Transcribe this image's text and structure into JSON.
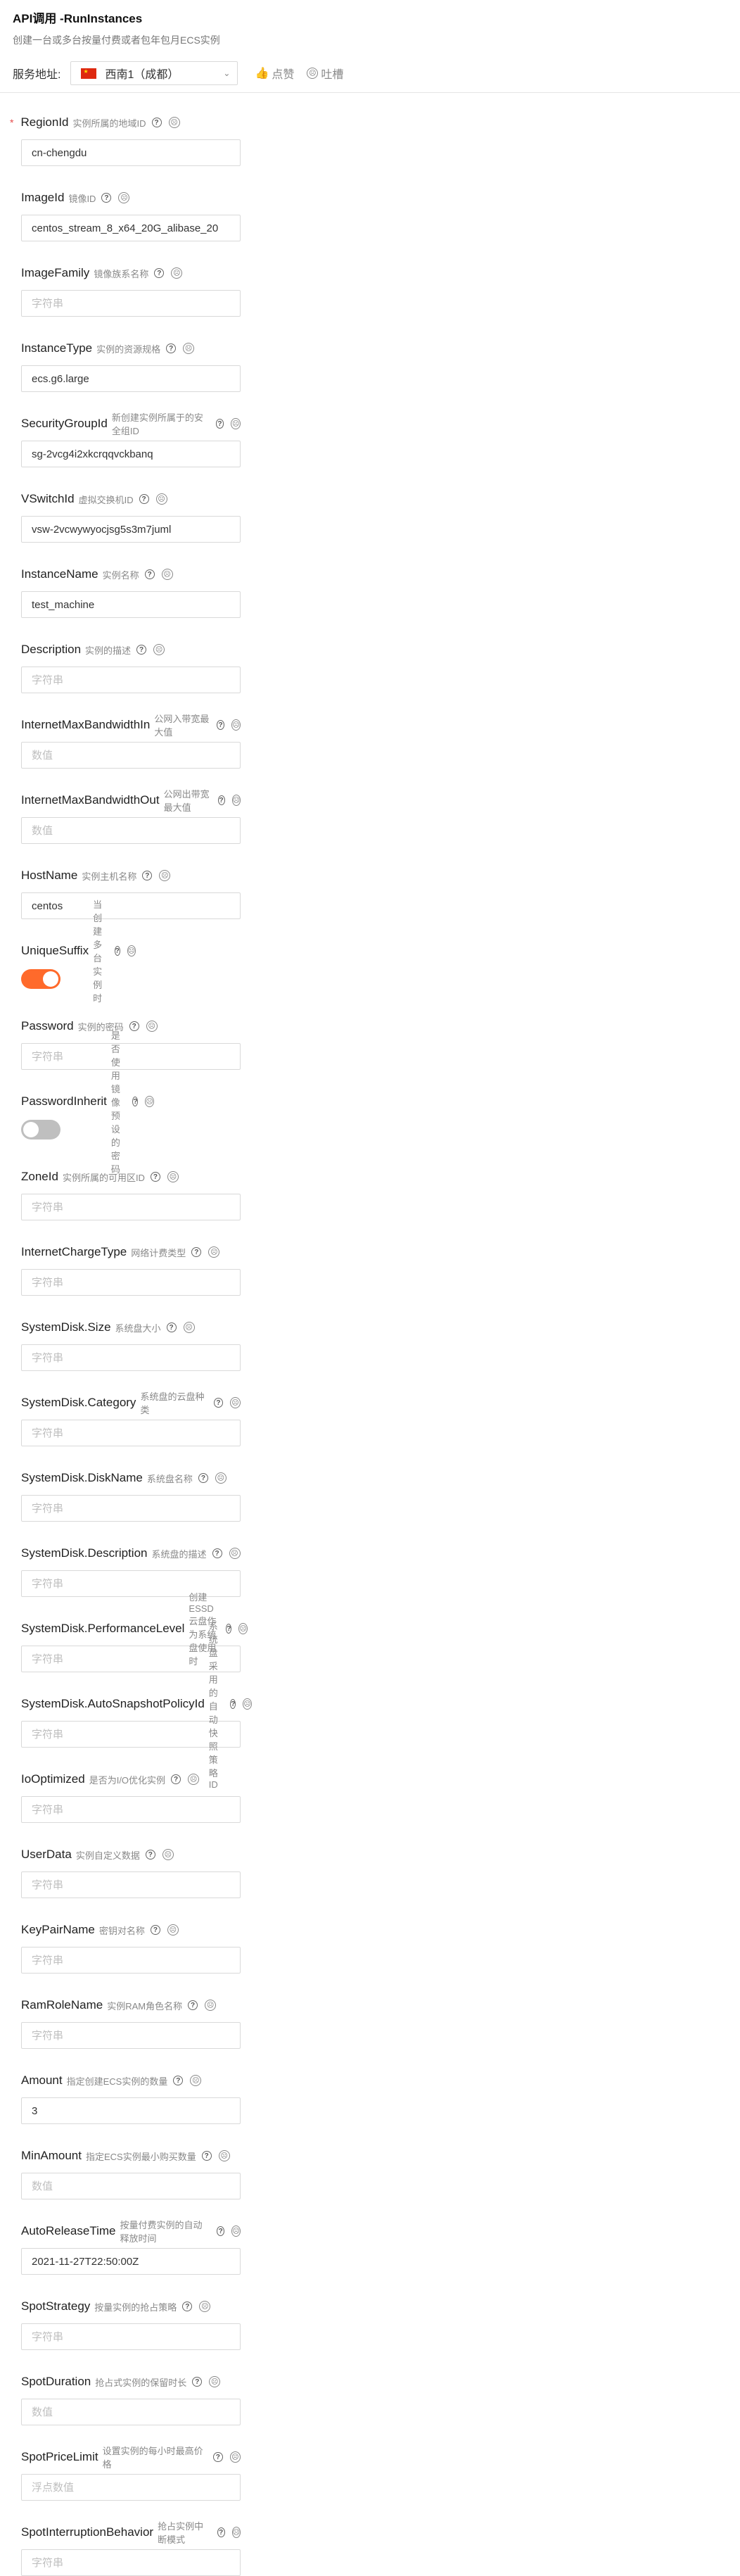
{
  "header": {
    "title": "API调用 -RunInstances",
    "subtitle": "创建一台或多台按量付费或者包年包月ECS实例",
    "service_label": "服务地址:",
    "region": "西南1（成都）",
    "like_label": "点赞",
    "complain_label": "吐槽"
  },
  "colors": {
    "accent": "#ff6a2b",
    "required": "#e54b4b"
  },
  "fields": [
    {
      "name": "RegionId",
      "desc": "实例所属的地域ID",
      "required": true,
      "value": "cn-chengdu",
      "placeholder": ""
    },
    {
      "name": "ImageId",
      "desc": "镜像ID",
      "value": "centos_stream_8_x64_20G_alibase_20",
      "placeholder": ""
    },
    {
      "name": "ImageFamily",
      "desc": "镜像族系名称",
      "value": "",
      "placeholder": "字符串"
    },
    {
      "name": "InstanceType",
      "desc": "实例的资源规格",
      "value": "ecs.g6.large",
      "placeholder": ""
    },
    {
      "name": "SecurityGroupId",
      "desc": "新创建实例所属于的安全组ID",
      "value": "sg-2vcg4i2xkcrqqvckbanq",
      "placeholder": ""
    },
    {
      "name": "VSwitchId",
      "desc": "虚拟交换机ID",
      "value": "vsw-2vcwywyocjsg5s3m7juml",
      "placeholder": ""
    },
    {
      "name": "InstanceName",
      "desc": "实例名称",
      "value": "test_machine",
      "placeholder": ""
    },
    {
      "name": "Description",
      "desc": "实例的描述",
      "value": "",
      "placeholder": "字符串"
    },
    {
      "name": "InternetMaxBandwidthIn",
      "desc": "公网入带宽最大值",
      "value": "",
      "placeholder": "数值"
    },
    {
      "name": "InternetMaxBandwidthOut",
      "desc": "公网出带宽最大值",
      "value": "",
      "placeholder": "数值"
    },
    {
      "name": "HostName",
      "desc": "实例主机名称",
      "value": "centos",
      "placeholder": ""
    },
    {
      "name": "UniqueSuffix",
      "desc": "当创建多台实例时",
      "toggle": true,
      "on": true
    },
    {
      "name": "Password",
      "desc": "实例的密码",
      "value": "",
      "placeholder": "字符串"
    },
    {
      "name": "PasswordInherit",
      "desc": "是否使用镜像预设的密码",
      "toggle": true,
      "on": false
    },
    {
      "name": "ZoneId",
      "desc": "实例所属的可用区ID",
      "value": "",
      "placeholder": "字符串"
    },
    {
      "name": "InternetChargeType",
      "desc": "网络计费类型",
      "value": "",
      "placeholder": "字符串"
    },
    {
      "name": "SystemDisk.Size",
      "desc": "系统盘大小",
      "value": "",
      "placeholder": "字符串"
    },
    {
      "name": "SystemDisk.Category",
      "desc": "系统盘的云盘种类",
      "value": "",
      "placeholder": "字符串"
    },
    {
      "name": "SystemDisk.DiskName",
      "desc": "系统盘名称",
      "value": "",
      "placeholder": "字符串"
    },
    {
      "name": "SystemDisk.Description",
      "desc": "系统盘的描述",
      "value": "",
      "placeholder": "字符串"
    },
    {
      "name": "SystemDisk.PerformanceLevel",
      "desc": "创建ESSD云盘作为系统盘使用时",
      "value": "",
      "placeholder": "字符串"
    },
    {
      "name": "SystemDisk.AutoSnapshotPolicyId",
      "desc": "系统盘采用的自动快照策略ID",
      "value": "",
      "placeholder": "字符串"
    },
    {
      "name": "IoOptimized",
      "desc": "是否为I/O优化实例",
      "value": "",
      "placeholder": "字符串"
    },
    {
      "name": "UserData",
      "desc": "实例自定义数据",
      "value": "",
      "placeholder": "字符串"
    },
    {
      "name": "KeyPairName",
      "desc": "密钥对名称",
      "value": "",
      "placeholder": "字符串"
    },
    {
      "name": "RamRoleName",
      "desc": "实例RAM角色名称",
      "value": "",
      "placeholder": "字符串"
    },
    {
      "name": "Amount",
      "desc": "指定创建ECS实例的数量",
      "value": "3",
      "placeholder": ""
    },
    {
      "name": "MinAmount",
      "desc": "指定ECS实例最小购买数量",
      "value": "",
      "placeholder": "数值"
    },
    {
      "name": "AutoReleaseTime",
      "desc": "按量付费实例的自动释放时间",
      "value": "2021-11-27T22:50:00Z",
      "placeholder": ""
    },
    {
      "name": "SpotStrategy",
      "desc": "按量实例的抢占策略",
      "value": "",
      "placeholder": "字符串"
    },
    {
      "name": "SpotDuration",
      "desc": "抢占式实例的保留时长",
      "value": "",
      "placeholder": "数值"
    },
    {
      "name": "SpotPriceLimit",
      "desc": "设置实例的每小时最高价格",
      "value": "",
      "placeholder": "浮点数值"
    },
    {
      "name": "SpotInterruptionBehavior",
      "desc": "抢占实例中断模式",
      "value": "",
      "placeholder": "字符串"
    }
  ]
}
